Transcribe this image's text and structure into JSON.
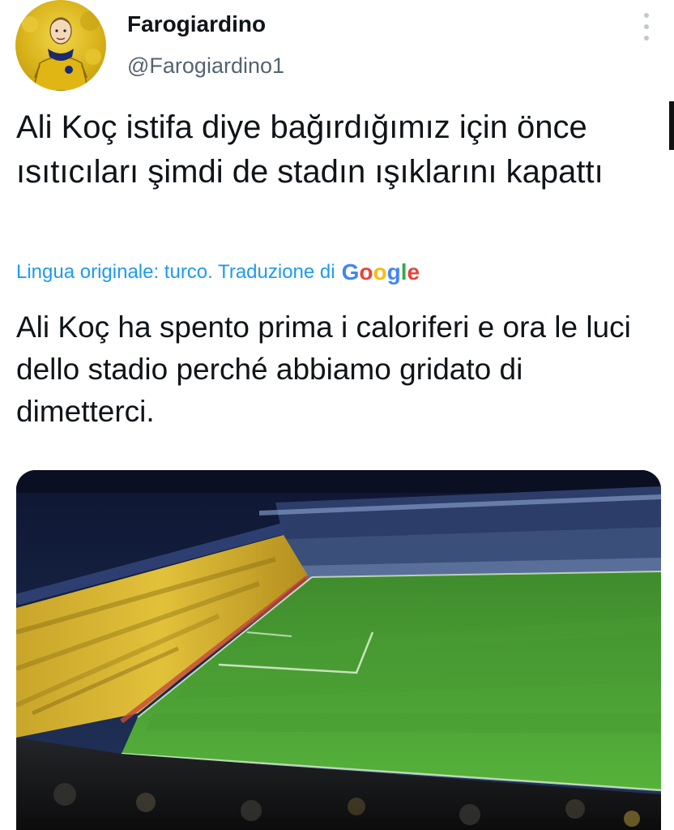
{
  "author": {
    "display_name": "Farogiardino",
    "handle": "@Farogiardino1"
  },
  "tweet": {
    "text": "Ali Koç istifa diye bağırdığımız için önce ısıtıcıları şimdi de stadın ışıklarını kapattı",
    "translation_label": "Lingua originale: turco. Traduzione di",
    "translation_provider": "Google",
    "translated_text": "Ali Koç ha spento prima i caloriferi e ora le luci dello stadio perché abbiamo gridato di dimetterci."
  },
  "icons": {
    "more": "more-vertical-icon",
    "avatar": "avatar-image",
    "media": "stadium-video-thumbnail"
  },
  "colors": {
    "link_blue": "#1d9bf0",
    "handle_gray": "#536471",
    "text": "#0f1419"
  }
}
